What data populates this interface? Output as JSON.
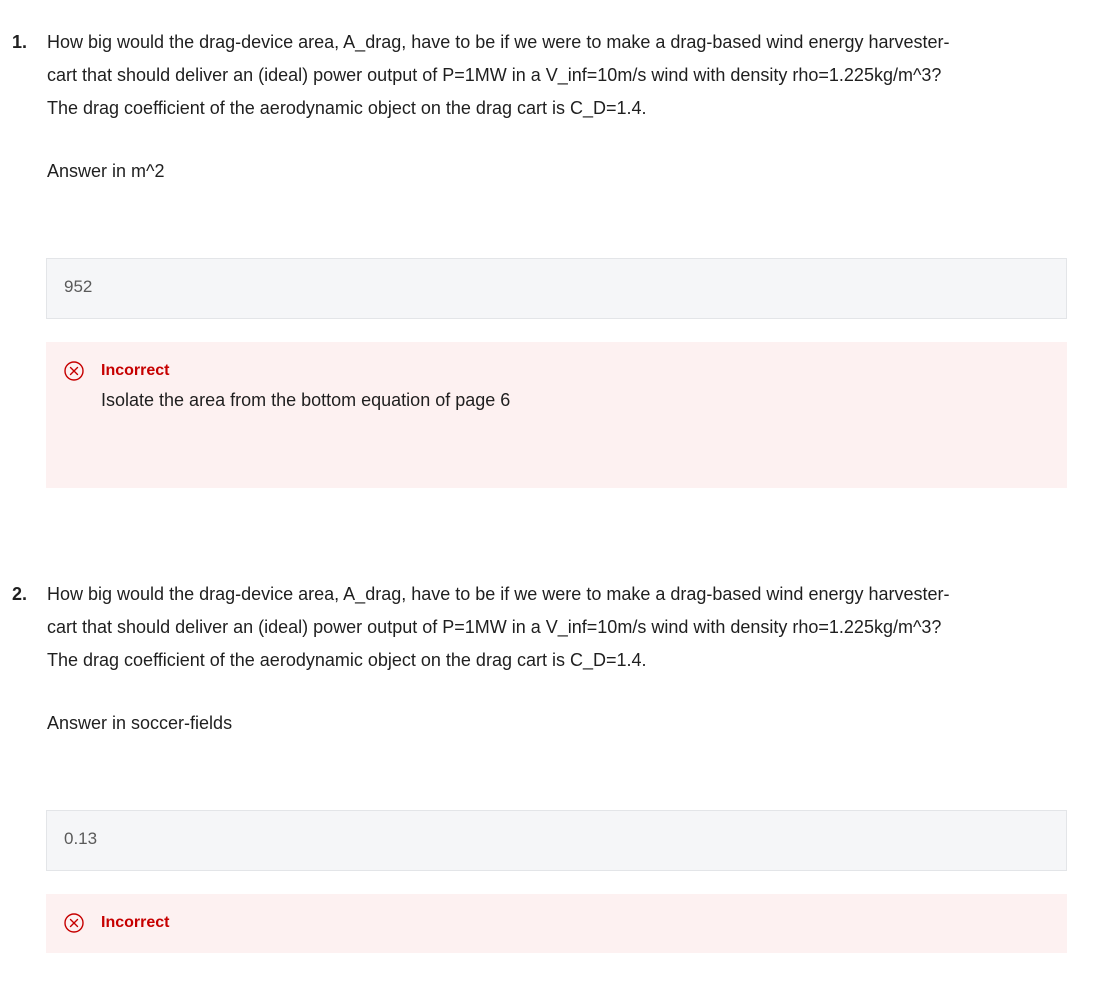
{
  "questions": [
    {
      "number": "1.",
      "text_lines": [
        "How big would the drag-device area, A_drag, have to be if we were to make a drag-based wind energy harvester-",
        "cart that should deliver an (ideal) power output of P=1MW in a V_inf=10m/s wind with density rho=1.225kg/m^3?",
        "The drag coefficient of the aerodynamic object on the drag cart is C_D=1.4."
      ],
      "unit_prompt": "Answer in m^2",
      "answer_value": "952",
      "feedback": {
        "status": "Incorrect",
        "message": "Isolate the area from the bottom equation of page 6",
        "icon": "close-circle-icon"
      }
    },
    {
      "number": "2.",
      "text_lines": [
        "How big would the drag-device area, A_drag, have to be if we were to make a drag-based wind energy harvester-",
        "cart that should deliver an (ideal) power output of P=1MW in a V_inf=10m/s wind with density rho=1.225kg/m^3?",
        "The drag coefficient of the aerodynamic object on the drag cart is C_D=1.4."
      ],
      "unit_prompt": "Answer in soccer-fields",
      "answer_value": "0.13",
      "feedback": {
        "status": "Incorrect",
        "icon": "close-circle-icon"
      }
    }
  ],
  "colors": {
    "incorrect": "#c60000",
    "feedback_bg": "#fdf1f1",
    "answer_bg": "#f5f6f8"
  }
}
